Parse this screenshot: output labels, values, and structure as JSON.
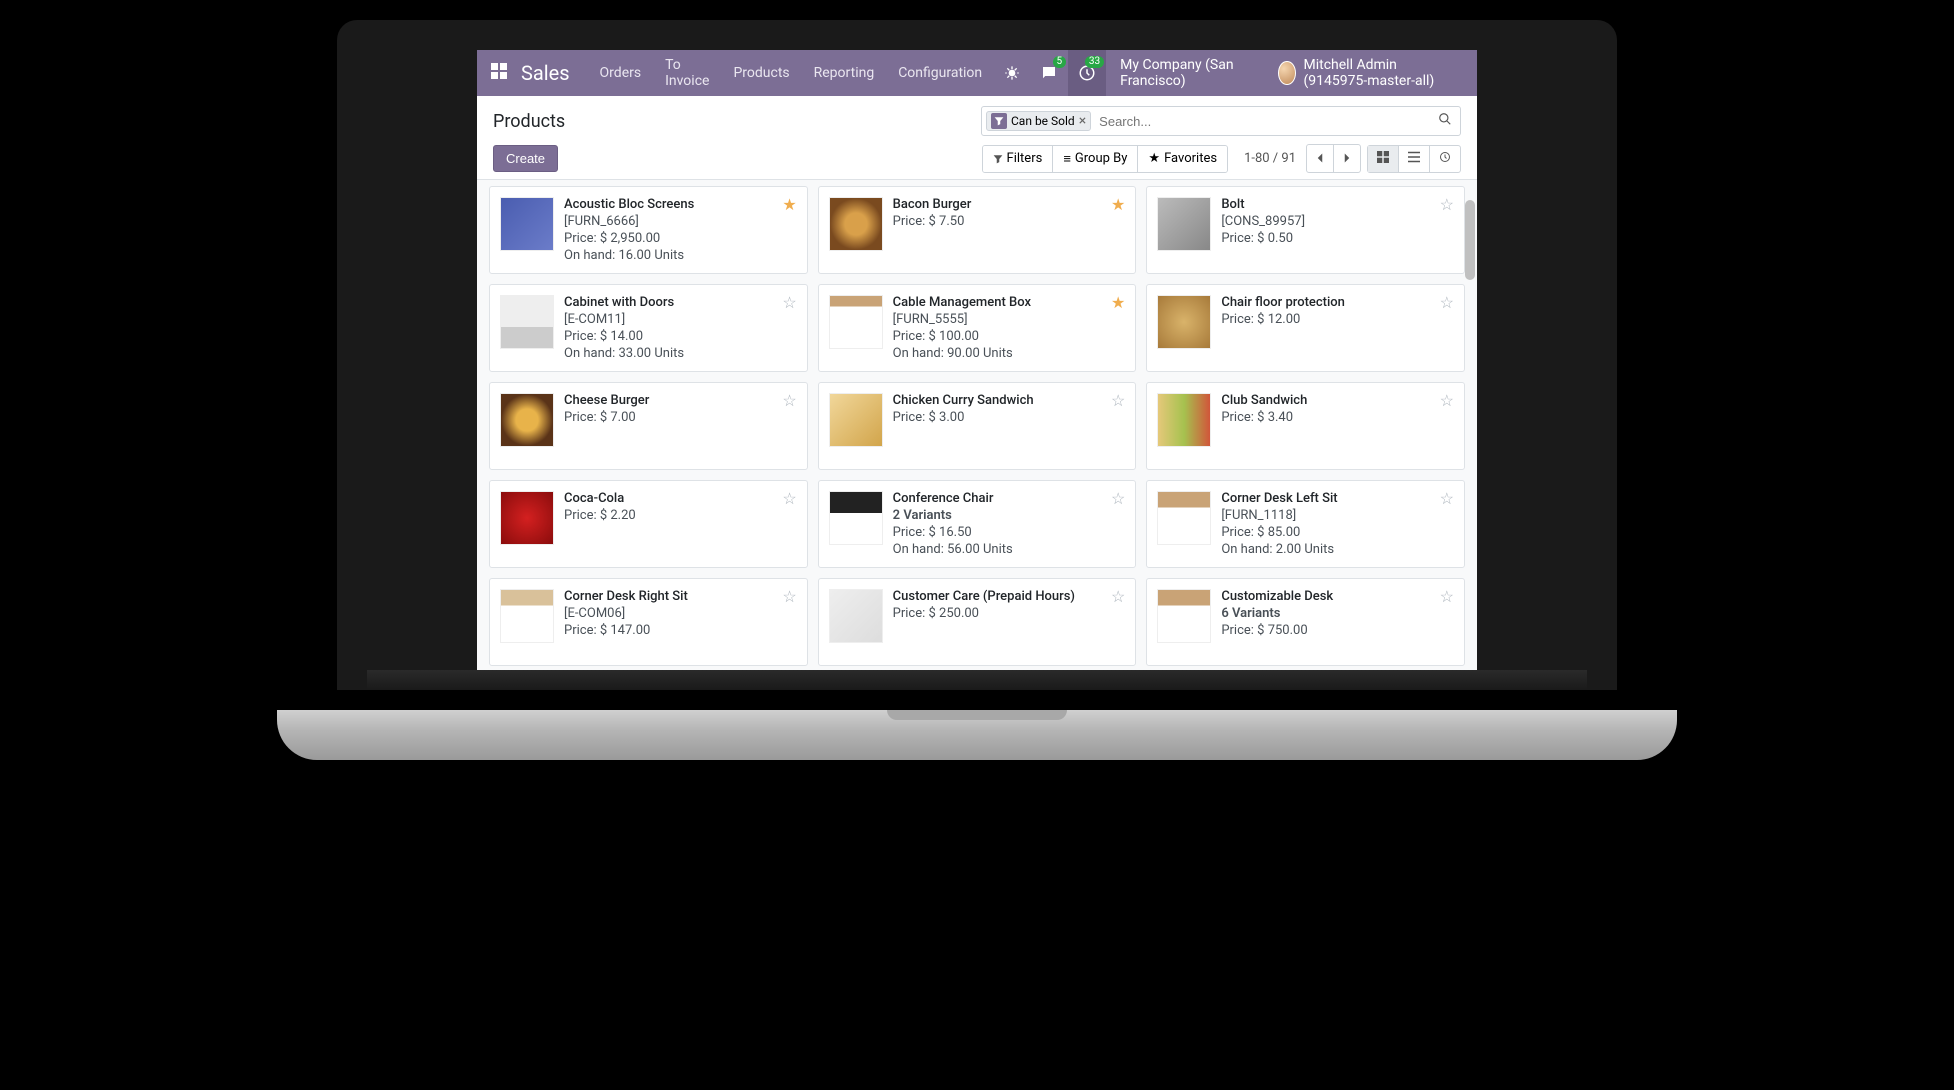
{
  "nav": {
    "app_name": "Sales",
    "items": [
      "Orders",
      "To Invoice",
      "Products",
      "Reporting",
      "Configuration"
    ],
    "messaging_badge": "5",
    "activity_badge": "33",
    "company": "My Company (San Francisco)",
    "user": "Mitchell Admin (9145975-master-all)"
  },
  "breadcrumb": "Products",
  "search": {
    "chip_label": "Can be Sold",
    "placeholder": "Search..."
  },
  "buttons": {
    "create": "Create",
    "filters": "Filters",
    "groupby": "Group By",
    "favorites": "Favorites"
  },
  "pager": "1-80 / 91",
  "products": [
    {
      "name": "Acoustic Bloc Screens",
      "ref": "[FURN_6666]",
      "price": "Price: $ 2,950.00",
      "onhand": "On hand: 16.00 Units",
      "fav": true
    },
    {
      "name": "Bacon Burger",
      "ref": "",
      "price": "Price: $ 7.50",
      "onhand": "",
      "fav": true
    },
    {
      "name": "Bolt",
      "ref": "[CONS_89957]",
      "price": "Price: $ 0.50",
      "onhand": "",
      "fav": false
    },
    {
      "name": "Cabinet with Doors",
      "ref": "[E-COM11]",
      "price": "Price: $ 14.00",
      "onhand": "On hand: 33.00 Units",
      "fav": false
    },
    {
      "name": "Cable Management Box",
      "ref": "[FURN_5555]",
      "price": "Price: $ 100.00",
      "onhand": "On hand: 90.00 Units",
      "fav": true
    },
    {
      "name": "Chair floor protection",
      "ref": "",
      "price": "Price: $ 12.00",
      "onhand": "",
      "fav": false
    },
    {
      "name": "Cheese Burger",
      "ref": "",
      "price": "Price: $ 7.00",
      "onhand": "",
      "fav": false
    },
    {
      "name": "Chicken Curry Sandwich",
      "ref": "",
      "price": "Price: $ 3.00",
      "onhand": "",
      "fav": false
    },
    {
      "name": "Club Sandwich",
      "ref": "",
      "price": "Price: $ 3.40",
      "onhand": "",
      "fav": false
    },
    {
      "name": "Coca-Cola",
      "ref": "",
      "price": "Price: $ 2.20",
      "onhand": "",
      "fav": false
    },
    {
      "name": "Conference Chair",
      "ref": "2 Variants",
      "price": "Price: $ 16.50",
      "onhand": "On hand: 56.00 Units",
      "fav": false
    },
    {
      "name": "Corner Desk Left Sit",
      "ref": "[FURN_1118]",
      "price": "Price: $ 85.00",
      "onhand": "On hand: 2.00 Units",
      "fav": false
    },
    {
      "name": "Corner Desk Right Sit",
      "ref": "[E-COM06]",
      "price": "Price: $ 147.00",
      "onhand": "",
      "fav": false
    },
    {
      "name": "Customer Care (Prepaid Hours)",
      "ref": "",
      "price": "Price: $ 250.00",
      "onhand": "",
      "fav": false
    },
    {
      "name": "Customizable Desk",
      "ref": "6 Variants",
      "price": "Price: $ 750.00",
      "onhand": "",
      "fav": false
    }
  ]
}
